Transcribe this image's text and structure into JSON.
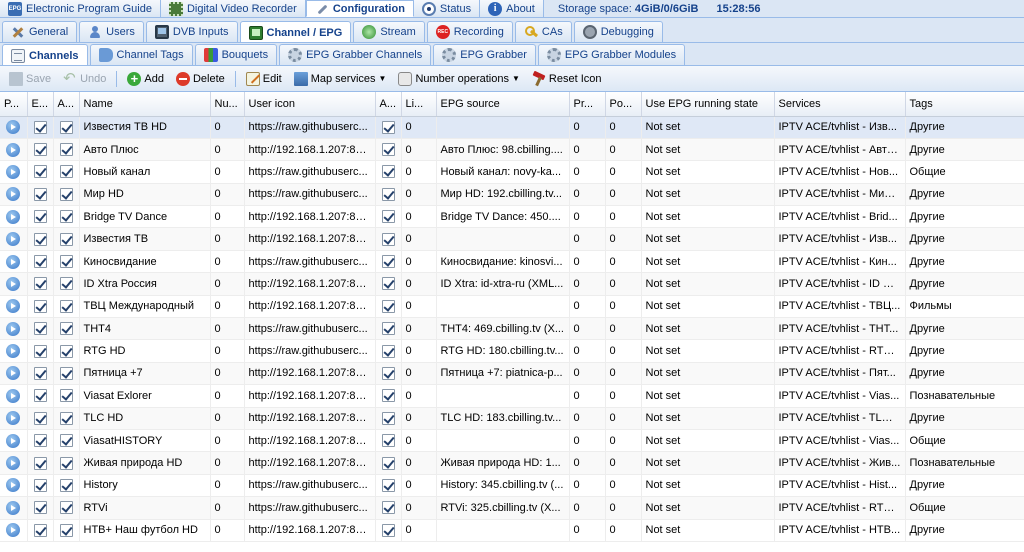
{
  "top_tabs": [
    {
      "label": "Electronic Program Guide",
      "icon": "epg-icon",
      "active": false
    },
    {
      "label": "Digital Video Recorder",
      "icon": "film-icon",
      "active": false
    },
    {
      "label": "Configuration",
      "icon": "wrench-icon",
      "active": true
    },
    {
      "label": "Status",
      "icon": "eye-icon",
      "active": false
    },
    {
      "label": "About",
      "icon": "info-icon",
      "active": false
    }
  ],
  "status": {
    "storage_label": "Storage space:",
    "storage_value": "4GiB/0/6GiB",
    "time": "15:28:56"
  },
  "config_tabs": [
    {
      "label": "General",
      "icon": "tools-icon",
      "active": false
    },
    {
      "label": "Users",
      "icon": "users-icon",
      "active": false
    },
    {
      "label": "DVB Inputs",
      "icon": "tv-icon",
      "active": false
    },
    {
      "label": "Channel / EPG",
      "icon": "channel-icon",
      "active": true
    },
    {
      "label": "Stream",
      "icon": "stream-icon",
      "active": false
    },
    {
      "label": "Recording",
      "icon": "rec-icon",
      "active": false
    },
    {
      "label": "CAs",
      "icon": "key-icon",
      "active": false
    },
    {
      "label": "Debugging",
      "icon": "debug-icon",
      "active": false
    }
  ],
  "sub_tabs": [
    {
      "label": "Channels",
      "icon": "doc-icon",
      "active": true
    },
    {
      "label": "Channel Tags",
      "icon": "tag-icon",
      "active": false
    },
    {
      "label": "Bouquets",
      "icon": "grid-icon",
      "active": false
    },
    {
      "label": "EPG Grabber Channels",
      "icon": "gear-icon",
      "active": false
    },
    {
      "label": "EPG Grabber",
      "icon": "gear-icon",
      "active": false
    },
    {
      "label": "EPG Grabber Modules",
      "icon": "gear-icon",
      "active": false
    }
  ],
  "toolbar": {
    "save": "Save",
    "undo": "Undo",
    "add": "Add",
    "delete": "Delete",
    "edit": "Edit",
    "map_services": "Map services",
    "number_operations": "Number operations",
    "reset_icon": "Reset Icon"
  },
  "columns": [
    "P...",
    "E...",
    "A...",
    "Name",
    "Nu...",
    "User icon",
    "A...",
    "Li...",
    "EPG source",
    "Pr...",
    "Po...",
    "Use EPG running state",
    "Services",
    "Tags"
  ],
  "rows": [
    {
      "name": "Известия ТВ HD",
      "number": "0",
      "icon": "https://raw.githubuserc...",
      "li": "0",
      "epg": "",
      "pr": "0",
      "po": "0",
      "state": "Not set",
      "services": "IPTV ACE/tvhlist - Изв...",
      "tags": "Другие"
    },
    {
      "name": "Авто Плюс",
      "number": "0",
      "icon": "http://192.168.1.207:81...",
      "li": "0",
      "epg": "Авто Плюс: 98.cbilling....",
      "pr": "0",
      "po": "0",
      "state": "Not set",
      "services": "IPTV ACE/tvhlist - Авто...",
      "tags": "Другие"
    },
    {
      "name": "Новый канал",
      "number": "0",
      "icon": "https://raw.githubuserc...",
      "li": "0",
      "epg": "Новый канал: novy-ka...",
      "pr": "0",
      "po": "0",
      "state": "Not set",
      "services": "IPTV ACE/tvhlist - Нов...",
      "tags": "Общие"
    },
    {
      "name": "Мир HD",
      "number": "0",
      "icon": "https://raw.githubuserc...",
      "li": "0",
      "epg": "Мир HD: 192.cbilling.tv...",
      "pr": "0",
      "po": "0",
      "state": "Not set",
      "services": "IPTV ACE/tvhlist - Мир ...",
      "tags": "Другие"
    },
    {
      "name": "Bridge TV Dance",
      "number": "0",
      "icon": "http://192.168.1.207:81...",
      "li": "0",
      "epg": "Bridge TV Dance: 450....",
      "pr": "0",
      "po": "0",
      "state": "Not set",
      "services": "IPTV ACE/tvhlist - Brid...",
      "tags": "Другие"
    },
    {
      "name": "Известия ТВ",
      "number": "0",
      "icon": "http://192.168.1.207:81...",
      "li": "0",
      "epg": "",
      "pr": "0",
      "po": "0",
      "state": "Not set",
      "services": "IPTV ACE/tvhlist - Изв...",
      "tags": "Другие"
    },
    {
      "name": "Киносвидание",
      "number": "0",
      "icon": "https://raw.githubuserc...",
      "li": "0",
      "epg": "Киносвидание: kinosvi...",
      "pr": "0",
      "po": "0",
      "state": "Not set",
      "services": "IPTV ACE/tvhlist - Кин...",
      "tags": "Другие"
    },
    {
      "name": "ID Xtra Россия",
      "number": "0",
      "icon": "http://192.168.1.207:81...",
      "li": "0",
      "epg": "ID Xtra: id-xtra-ru (XML...",
      "pr": "0",
      "po": "0",
      "state": "Not set",
      "services": "IPTV ACE/tvhlist - ID Xt...",
      "tags": "Другие"
    },
    {
      "name": "ТВЦ Международный",
      "number": "0",
      "icon": "http://192.168.1.207:81...",
      "li": "0",
      "epg": "",
      "pr": "0",
      "po": "0",
      "state": "Not set",
      "services": "IPTV ACE/tvhlist - ТВЦ...",
      "tags": "Фильмы"
    },
    {
      "name": "ТНТ4",
      "number": "0",
      "icon": "https://raw.githubuserc...",
      "li": "0",
      "epg": "ТНТ4: 469.cbilling.tv (X...",
      "pr": "0",
      "po": "0",
      "state": "Not set",
      "services": "IPTV ACE/tvhlist - ТНТ...",
      "tags": "Другие"
    },
    {
      "name": "RTG HD",
      "number": "0",
      "icon": "https://raw.githubuserc...",
      "li": "0",
      "epg": "RTG HD: 180.cbilling.tv...",
      "pr": "0",
      "po": "0",
      "state": "Not set",
      "services": "IPTV ACE/tvhlist - RTG...",
      "tags": "Другие"
    },
    {
      "name": "Пятница +7",
      "number": "0",
      "icon": "http://192.168.1.207:81...",
      "li": "0",
      "epg": "Пятница +7: piatnica-p...",
      "pr": "0",
      "po": "0",
      "state": "Not set",
      "services": "IPTV ACE/tvhlist - Пят...",
      "tags": "Другие"
    },
    {
      "name": "Viasat Exlorer",
      "number": "0",
      "icon": "http://192.168.1.207:81...",
      "li": "0",
      "epg": "",
      "pr": "0",
      "po": "0",
      "state": "Not set",
      "services": "IPTV ACE/tvhlist - Vias...",
      "tags": "Познавательные"
    },
    {
      "name": "TLC HD",
      "number": "0",
      "icon": "http://192.168.1.207:81...",
      "li": "0",
      "epg": "TLC HD: 183.cbilling.tv...",
      "pr": "0",
      "po": "0",
      "state": "Not set",
      "services": "IPTV ACE/tvhlist - TLC ...",
      "tags": "Другие"
    },
    {
      "name": "ViasatHISTORY",
      "number": "0",
      "icon": "http://192.168.1.207:81...",
      "li": "0",
      "epg": "",
      "pr": "0",
      "po": "0",
      "state": "Not set",
      "services": "IPTV ACE/tvhlist - Vias...",
      "tags": "Общие"
    },
    {
      "name": "Живая природа HD",
      "number": "0",
      "icon": "http://192.168.1.207:81...",
      "li": "0",
      "epg": "Живая природа HD: 1...",
      "pr": "0",
      "po": "0",
      "state": "Not set",
      "services": "IPTV ACE/tvhlist - Жив...",
      "tags": "Познавательные"
    },
    {
      "name": "History",
      "number": "0",
      "icon": "https://raw.githubuserc...",
      "li": "0",
      "epg": "History: 345.cbilling.tv (...",
      "pr": "0",
      "po": "0",
      "state": "Not set",
      "services": "IPTV ACE/tvhlist - Hist...",
      "tags": "Другие"
    },
    {
      "name": "RTVi",
      "number": "0",
      "icon": "https://raw.githubuserc...",
      "li": "0",
      "epg": "RTVi: 325.cbilling.tv (X...",
      "pr": "0",
      "po": "0",
      "state": "Not set",
      "services": "IPTV ACE/tvhlist - RTVi...",
      "tags": "Общие"
    },
    {
      "name": "НТВ+ Наш футбол HD",
      "number": "0",
      "icon": "http://192.168.1.207:81...",
      "li": "0",
      "epg": "",
      "pr": "0",
      "po": "0",
      "state": "Not set",
      "services": "IPTV ACE/tvhlist - НТВ...",
      "tags": "Другие"
    }
  ]
}
